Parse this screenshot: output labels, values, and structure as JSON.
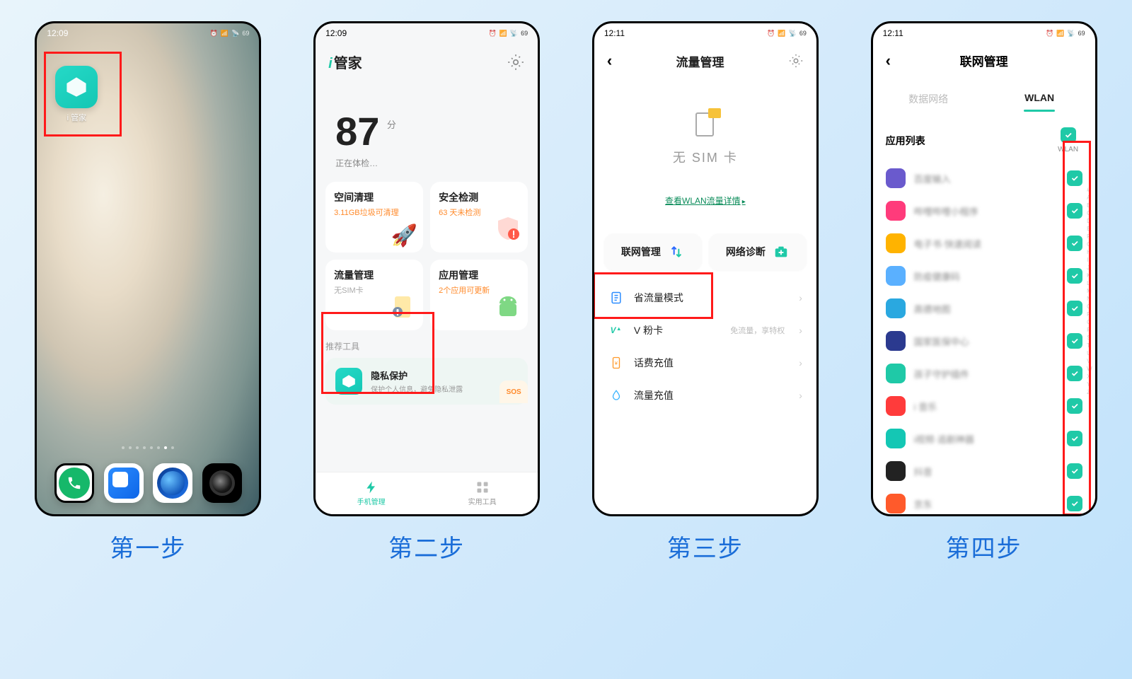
{
  "common": {
    "time_a": "12:09",
    "time_b": "12:11",
    "battery": "69"
  },
  "steps": {
    "s1": "第一步",
    "s2": "第二步",
    "s3": "第三步",
    "s4": "第四步"
  },
  "phone1": {
    "app_name": "i 管家"
  },
  "phone2": {
    "title": "管家",
    "score": "87",
    "score_unit": "分",
    "scan_status": "正在体检…",
    "cards": {
      "clean_title": "空间清理",
      "clean_sub": "3.11GB垃圾可清理",
      "safe_title": "安全检测",
      "safe_sub": "63 天未检测",
      "data_title": "流量管理",
      "data_sub": "无SIM卡",
      "app_title": "应用管理",
      "app_sub": "2个应用可更新"
    },
    "rec_title": "推荐工具",
    "privacy_title": "隐私保护",
    "privacy_sub": "保护个人信息，避免隐私泄露",
    "sos": "SOS",
    "tab1": "手机管理",
    "tab2": "实用工具"
  },
  "phone3": {
    "title": "流量管理",
    "no_sim": "无 SIM 卡",
    "wlan_link": "查看WLAN流量详情",
    "btn_network": "联网管理",
    "btn_diag": "网络诊断",
    "items": {
      "save": "省流量模式",
      "vcard": "V 粉卡",
      "vcard_sub": "免流量，享特权",
      "recharge": "话费充值",
      "data_recharge": "流量充值"
    }
  },
  "phone4": {
    "title": "联网管理",
    "tab_data": "数据网络",
    "tab_wlan": "WLAN",
    "section_title": "应用列表",
    "col_wlan": "WLAN",
    "apps": [
      {
        "color": "#6a5acd",
        "name": "百度输入"
      },
      {
        "color": "#ff3b7b",
        "name": "哔哩哔哩小程序"
      },
      {
        "color": "#ffb300",
        "name": "电子书·快速阅读"
      },
      {
        "color": "#5ab0ff",
        "name": "防疫健康码"
      },
      {
        "color": "#2aa8e0",
        "name": "高德地图"
      },
      {
        "color": "#2b3a8f",
        "name": "国家医保中心"
      },
      {
        "color": "#1fc9a7",
        "name": "孩子守护插件"
      },
      {
        "color": "#ff3b3b",
        "name": "i 音乐"
      },
      {
        "color": "#14c7b4",
        "name": "i视频·追剧神器"
      },
      {
        "color": "#222",
        "name": "抖音"
      },
      {
        "color": "#ff5a2b",
        "name": "京东"
      }
    ]
  }
}
